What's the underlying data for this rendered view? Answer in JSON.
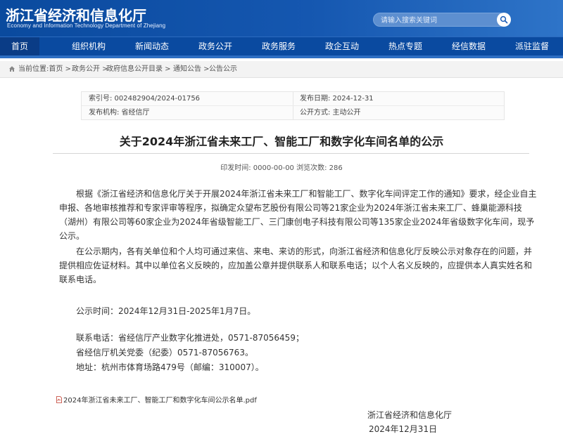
{
  "header": {
    "title": "浙江省经济和信息化厅",
    "subtitle": "Economy and Information Technology Department of Zhejiang",
    "search_placeholder": "请输入搜索关键词",
    "brand_color": "#0a4aa0"
  },
  "nav": {
    "items": [
      {
        "label": "首页"
      },
      {
        "label": "组织机构"
      },
      {
        "label": "新闻动态"
      },
      {
        "label": "政务公开"
      },
      {
        "label": "政务服务"
      },
      {
        "label": "政企互动"
      },
      {
        "label": "热点专题"
      },
      {
        "label": "经信数据"
      },
      {
        "label": "派驻监督"
      }
    ],
    "active": "首页"
  },
  "breadcrumb": {
    "items": [
      "当前位置:首页 >",
      "政务公开 >",
      "政府信息公开目录 >",
      "通知公告 >",
      "公告公示"
    ]
  },
  "meta": {
    "index_no": "索引号: 002482904/2024-01756",
    "publish_date": "发布日期: 2024-12-31",
    "issuer": "发布机构: 省经信厅",
    "disclosure": "公开方式: 主动公开"
  },
  "article": {
    "title": "关于2024年浙江省未来工厂、智能工厂和数字化车间名单的公示",
    "info": "印发时间:  0000-00-00      浏览次数:  286",
    "paragraphs": [
      "根据《浙江省经济和信息化厅关于开展2024年浙江省未来工厂和智能工厂、数字化车间评定工作的通知》要求，经企业自主申报、各地审核推荐和专家评审等程序，拟确定众望布艺股份有限公司等21家企业为2024年浙江省未来工厂、蜂巢能源科技（湖州）有限公司等60家企业为2024年省级智能工厂、三门康创电子科技有限公司等135家企业2024年省级数字化车间，现予公示。",
      "在公示期内，各有关单位和个人均可通过来信、来电、来访的形式，向浙江省经济和信息化厅反映公示对象存在的问题，并提供相应佐证材料。其中以单位名义反映的，应加盖公章并提供联系人和联系电话；以个人名义反映的，应提供本人真实姓名和联系电话。",
      "公示时间：2024年12月31日-2025年1月7日。",
      "联系电话：省经信厅产业数字化推进处，0571-87056459；",
      "省经信厅机关党委（纪委）0571-87056763。",
      "地址：杭州市体育场路479号（邮编：310007）。"
    ],
    "attachment": "2024年浙江省未来工厂、智能工厂和数字化车间公示名单.pdf",
    "signature_org": "浙江省经济和信息化厅",
    "signature_date": "2024年12月31日"
  }
}
